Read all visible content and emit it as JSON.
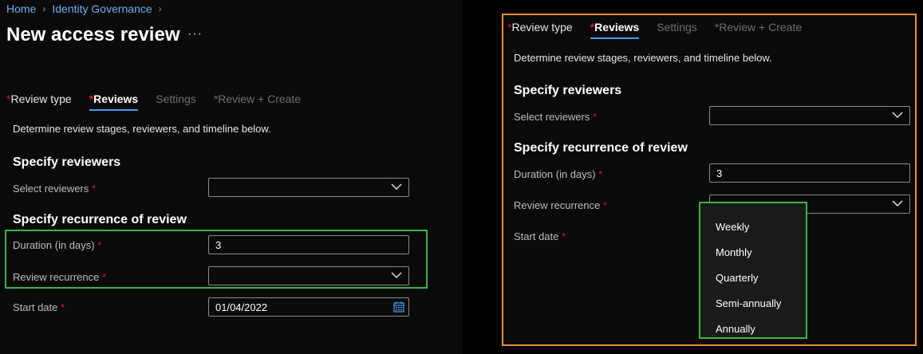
{
  "breadcrumb": {
    "home": "Home",
    "identity_governance": "Identity Governance"
  },
  "page": {
    "title": "New access review",
    "more": "···"
  },
  "tabs": [
    {
      "label": "Review type",
      "required": "*"
    },
    {
      "label": "Reviews",
      "required": "*"
    },
    {
      "label": "Settings"
    },
    {
      "label": "Review + Create",
      "required": "*"
    }
  ],
  "description": "Determine review stages, reviewers, and timeline below.",
  "sections": {
    "reviewers": "Specify reviewers",
    "recurrence": "Specify recurrence of review"
  },
  "fields": {
    "select_reviewers": {
      "label": "Select reviewers",
      "required": "*",
      "value": ""
    },
    "duration": {
      "label": "Duration (in days)",
      "required": "*",
      "value": "3"
    },
    "review_recurrence": {
      "label": "Review recurrence",
      "required": "*",
      "value": ""
    },
    "start_date": {
      "label": "Start date",
      "required": "*",
      "value": "01/04/2022"
    }
  },
  "recurrence_options": [
    "Weekly",
    "Monthly",
    "Quarterly",
    "Semi-annually",
    "Annually"
  ],
  "colors": {
    "highlight_green": "#3cb34a",
    "highlight_orange": "#f28c3a",
    "accent": "#4aa0ef",
    "required": "#e81123"
  },
  "icons": {
    "chevron": "chevron-right-icon",
    "dropdown": "chevron-down-icon",
    "calendar": "calendar-icon",
    "more": "more-icon"
  }
}
